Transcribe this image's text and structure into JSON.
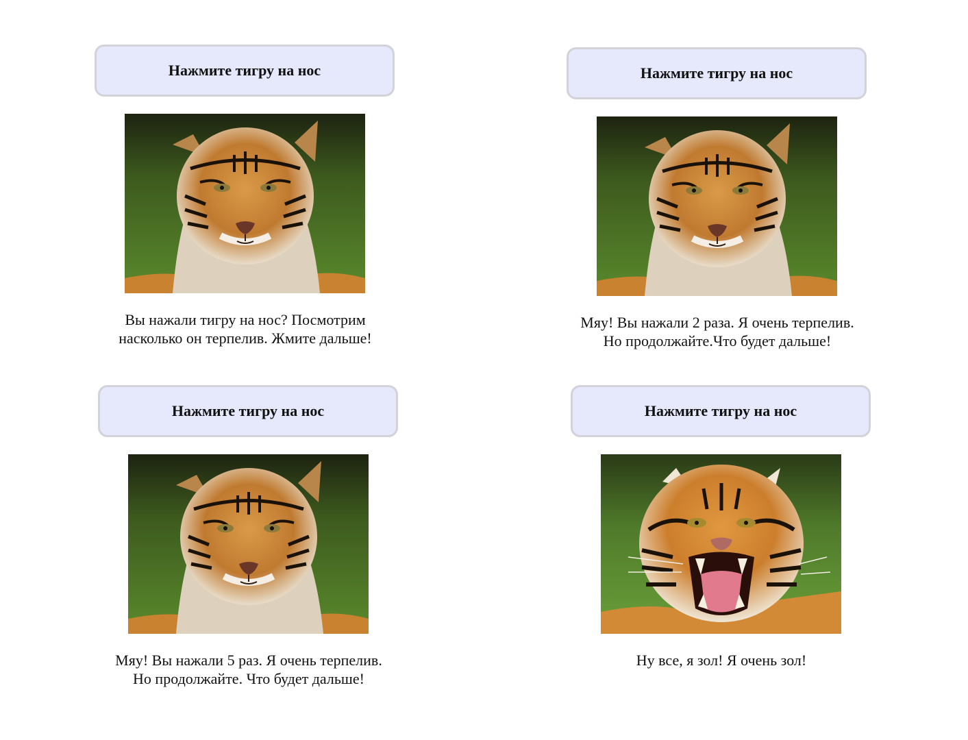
{
  "panels": [
    {
      "button_label": "Нажмите тигру на нос",
      "image": "calm-tiger",
      "caption_lines": [
        "Вы нажали тигру на нос? Посмотрим",
        "насколько он терпелив. Жмите дальше!"
      ]
    },
    {
      "button_label": "Нажмите тигру на нос",
      "image": "calm-tiger",
      "caption_lines": [
        "Мяу! Вы нажали 2 раза. Я очень терпелив.",
        "Но продолжайте.Что будет дальше!"
      ]
    },
    {
      "button_label": "Нажмите тигру на нос",
      "image": "calm-tiger",
      "caption_lines": [
        "Мяу! Вы нажали 5 раз. Я очень терпелив.",
        "Но продолжайте. Что будет дальше!"
      ]
    },
    {
      "button_label": "Нажмите тигру на нос",
      "image": "angry-roaring-tiger",
      "caption_lines": [
        "Ну все, я зол! Я очень зол!"
      ]
    }
  ],
  "colors": {
    "button_background": "#e5e9fb",
    "button_border": "#d2d2d8",
    "text": "#111111",
    "grass": "#4f7a2a",
    "fur_orange": "#c9822f"
  }
}
